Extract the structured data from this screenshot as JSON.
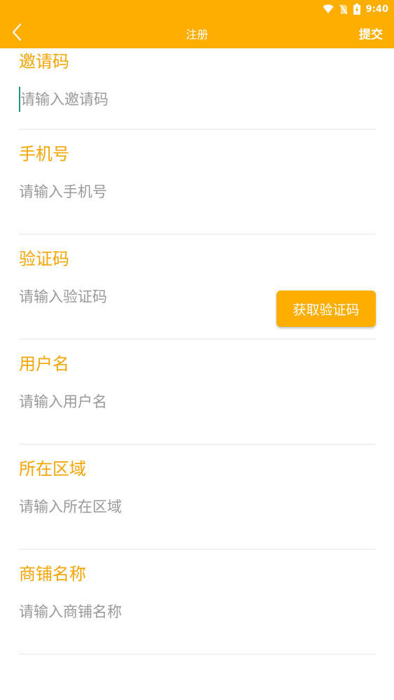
{
  "status_bar": {
    "time": "9:40"
  },
  "header": {
    "title": "注册",
    "submit_label": "提交"
  },
  "colors": {
    "accent": "#FDAE00",
    "label": "#F5A400",
    "placeholder": "#9a9a9a"
  },
  "fields": [
    {
      "label": "邀请码",
      "placeholder": "请输入邀请码"
    },
    {
      "label": "手机号",
      "placeholder": "请输入手机号"
    },
    {
      "label": "验证码",
      "placeholder": "请输入验证码",
      "button": "获取验证码"
    },
    {
      "label": "用户名",
      "placeholder": "请输入用户名"
    },
    {
      "label": "所在区域",
      "placeholder": "请输入所在区域"
    },
    {
      "label": "商铺名称",
      "placeholder": "请输入商铺名称"
    }
  ]
}
